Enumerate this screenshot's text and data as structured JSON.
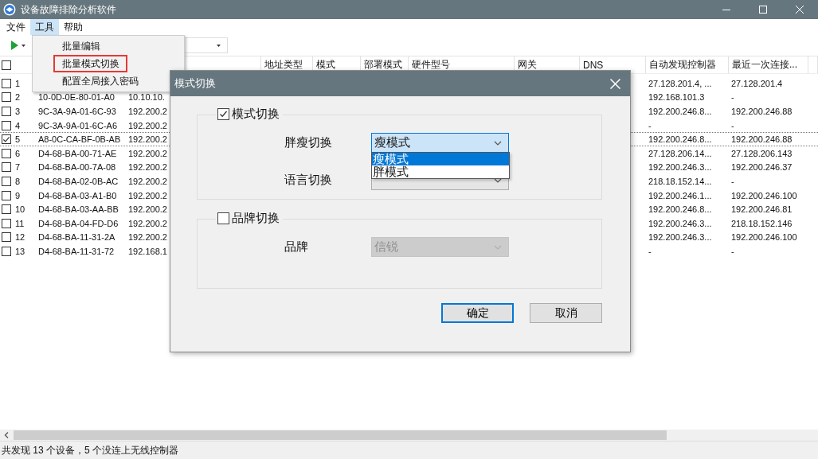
{
  "window": {
    "title": "设备故障排除分析软件"
  },
  "menu_bar": [
    {
      "label": "文件",
      "selected": false
    },
    {
      "label": "工具",
      "selected": true
    },
    {
      "label": "帮助",
      "selected": false
    }
  ],
  "tools_menu": {
    "items": [
      {
        "label": "批量编辑",
        "highlighted": false
      },
      {
        "label": "批量模式切换",
        "highlighted": true
      },
      {
        "label": "配置全局接入密码",
        "highlighted": false
      }
    ]
  },
  "table": {
    "select_all_checked": false,
    "columns": [
      "地址类型",
      "模式",
      "部署模式",
      "硬件型号",
      "网关",
      "DNS",
      "自动发现控制器",
      "最近一次连接..."
    ],
    "rows": [
      {
        "checked": false,
        "focused": false,
        "num": "1",
        "controller": "27.128.201.4, ...",
        "last": "27.128.201.4"
      },
      {
        "checked": false,
        "focused": false,
        "num": "2",
        "mac": "10-0D-0E-80-01-A0",
        "ip": "10.10.10.",
        "controller": "192.168.101.3",
        "last": "-"
      },
      {
        "checked": false,
        "focused": false,
        "num": "3",
        "mac": "9C-3A-9A-01-6C-93",
        "ip": "192.200.2",
        "controller": "192.200.246.8...",
        "last": "192.200.246.88"
      },
      {
        "checked": false,
        "focused": false,
        "num": "4",
        "mac": "9C-3A-9A-01-6C-A6",
        "ip": "192.200.2",
        "controller": "-",
        "last": "-"
      },
      {
        "checked": true,
        "focused": true,
        "num": "5",
        "mac": "A8-0C-CA-BF-0B-AB",
        "ip": "192.200.2",
        "controller": "192.200.246.8...",
        "last": "192.200.246.88"
      },
      {
        "checked": false,
        "focused": false,
        "num": "6",
        "mac": "D4-68-BA-00-71-AE",
        "ip": "192.200.2",
        "controller": "27.128.206.14...",
        "last": "27.128.206.143"
      },
      {
        "checked": false,
        "focused": false,
        "num": "7",
        "mac": "D4-68-BA-00-7A-08",
        "ip": "192.200.2",
        "controller": "192.200.246.3...",
        "last": "192.200.246.37"
      },
      {
        "checked": false,
        "focused": false,
        "num": "8",
        "mac": "D4-68-BA-02-0B-AC",
        "ip": "192.200.2",
        "controller": "218.18.152.14...",
        "last": "-"
      },
      {
        "checked": false,
        "focused": false,
        "num": "9",
        "mac": "D4-68-BA-03-A1-B0",
        "ip": "192.200.2",
        "controller": "192.200.246.1...",
        "last": "192.200.246.100"
      },
      {
        "checked": false,
        "focused": false,
        "num": "10",
        "mac": "D4-68-BA-03-AA-BB",
        "ip": "192.200.2",
        "controller": "192.200.246.8...",
        "last": "192.200.246.81"
      },
      {
        "checked": false,
        "focused": false,
        "num": "11",
        "mac": "D4-68-BA-04-FD-D6",
        "ip": "192.200.2",
        "controller": "192.200.246.3...",
        "last": "218.18.152.146"
      },
      {
        "checked": false,
        "focused": false,
        "num": "12",
        "mac": "D4-68-BA-11-31-2A",
        "ip": "192.200.2",
        "controller": "192.200.246.3...",
        "last": "192.200.246.100"
      },
      {
        "checked": false,
        "focused": false,
        "num": "13",
        "mac": "D4-68-BA-11-31-72",
        "ip": "192.168.1",
        "controller": "-",
        "last": "-"
      }
    ]
  },
  "dialog": {
    "title": "模式切换",
    "groups": [
      {
        "label": "模式切换",
        "checked": true,
        "fields": [
          {
            "label": "胖瘦切换",
            "value": "瘦模式",
            "open": true,
            "disabled": false,
            "options": [
              {
                "label": "瘦模式",
                "selected": true
              },
              {
                "label": "胖模式",
                "selected": false
              }
            ]
          },
          {
            "label": "语言切换",
            "open": false,
            "disabled": false
          }
        ]
      },
      {
        "label": "品牌切换",
        "checked": false,
        "fields": [
          {
            "label": "品牌",
            "value": "信锐",
            "open": false,
            "disabled": true
          }
        ]
      }
    ],
    "buttons": [
      {
        "label": "确定",
        "default": true
      },
      {
        "label": "取消",
        "default": false
      }
    ]
  },
  "status_bar": "共发现 13 个设备，5 个没连上无线控制器"
}
